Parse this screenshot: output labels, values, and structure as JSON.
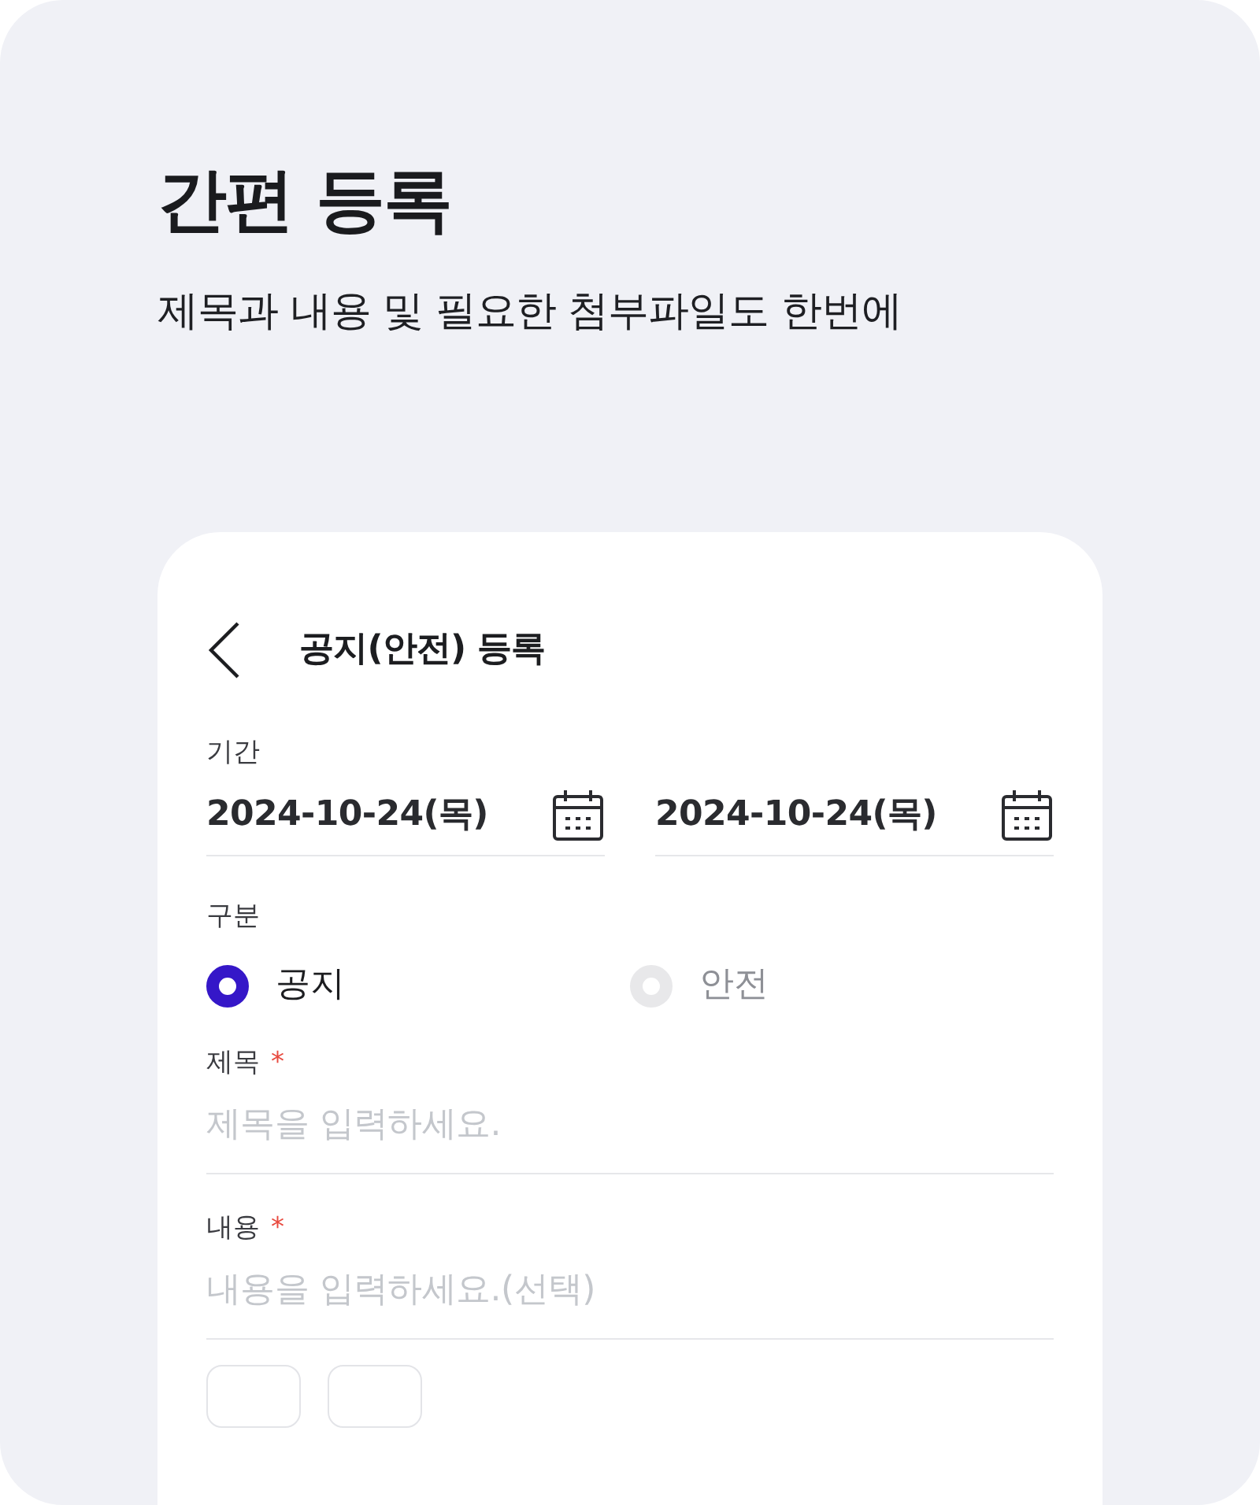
{
  "hero": {
    "title": "간편 등록",
    "subtitle": "제목과 내용 및 필요한 첨부파일도 한번에"
  },
  "form": {
    "title": "공지(안전) 등록",
    "period": {
      "label": "기간",
      "dates": [
        {
          "value": "2024-10-24(목)"
        },
        {
          "value": "2024-10-24(목)"
        }
      ]
    },
    "category": {
      "label": "구분",
      "options": [
        {
          "label": "공지",
          "selected": true
        },
        {
          "label": "안전",
          "selected": false
        }
      ]
    },
    "fields": [
      {
        "label": "제목",
        "required_mark": "*",
        "placeholder": "제목을 입력하세요."
      },
      {
        "label": "내용",
        "required_mark": "*",
        "placeholder": "내용을 입력하세요.(선택)"
      }
    ],
    "chips": [
      {
        "kind": "empty"
      },
      {
        "kind": "empty"
      }
    ]
  }
}
